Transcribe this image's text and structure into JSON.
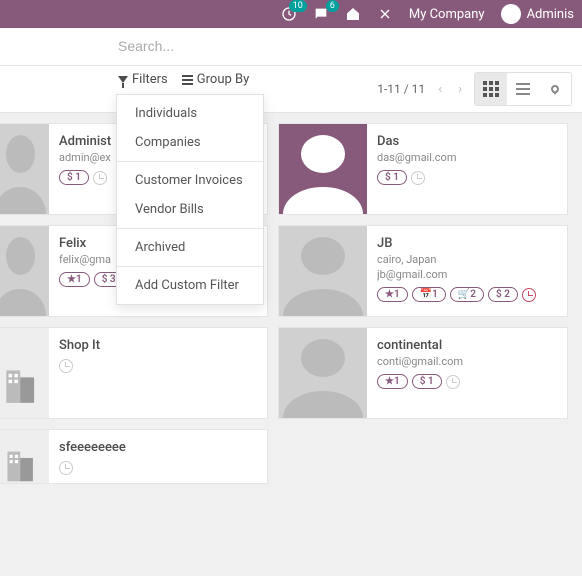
{
  "topbar": {
    "messages_badge": "10",
    "chat_badge": "6",
    "company": "My Company",
    "user": "Adminis"
  },
  "search": {
    "placeholder": "Search..."
  },
  "filterbar": {
    "filters_label": "Filters",
    "groupby_label": "Group By",
    "pager_text": "1-11 / 11"
  },
  "dropdown": {
    "individuals": "Individuals",
    "companies": "Companies",
    "customer_invoices": "Customer Invoices",
    "vendor_bills": "Vendor Bills",
    "archived": "Archived",
    "add_custom": "Add Custom Filter"
  },
  "cards": {
    "c0": {
      "name": "Administ",
      "sub": "admin@ex",
      "b0": "$ 1"
    },
    "c1": {
      "name": "Das",
      "sub": "das@gmail.com",
      "b0": "$ 1"
    },
    "c2": {
      "name": "Felix",
      "sub": "felix@gma",
      "b0": "★1",
      "b1": "$ 3"
    },
    "c3": {
      "name": "JB",
      "sub": "cairo, Japan",
      "sub2": "jb@gmail.com",
      "b0": "★1",
      "b1": "📅1",
      "b2": "🛒2",
      "b3": "$ 2"
    },
    "c4": {
      "name": "Shop It"
    },
    "c5": {
      "name": "continental",
      "sub": "conti@gmail.com",
      "b0": "★1",
      "b1": "$ 1"
    },
    "c6": {
      "name": "sfeeeeeeee"
    }
  }
}
